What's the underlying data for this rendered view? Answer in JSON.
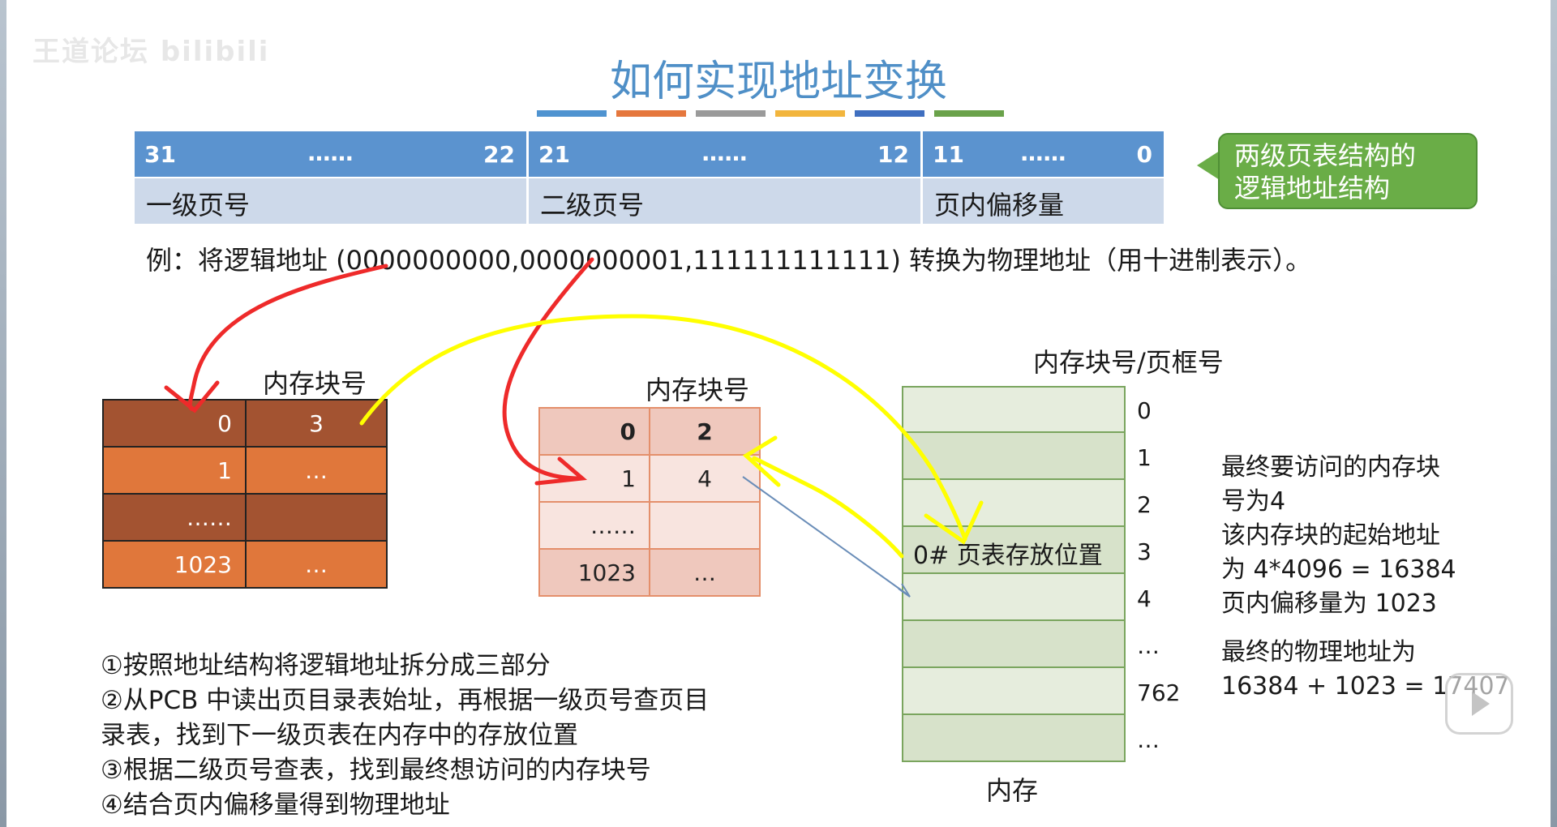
{
  "watermark": "王道论坛 bilibili",
  "title": "如何实现地址变换",
  "accent_colors": [
    "#4f93d0",
    "#e5773d",
    "#9a9a9a",
    "#f2b53d",
    "#3f6fc0",
    "#6aa24a"
  ],
  "address_structure": {
    "fields": [
      {
        "high_bit": "31",
        "dots": "……",
        "low_bit": "22",
        "label": "一级页号"
      },
      {
        "high_bit": "21",
        "dots": "……",
        "low_bit": "12",
        "label": "二级页号"
      },
      {
        "high_bit": "11",
        "dots": "……",
        "low_bit": "0",
        "label": "页内偏移量"
      }
    ],
    "callout_line1": "两级页表结构的",
    "callout_line2": "逻辑地址结构"
  },
  "example_text": "例：将逻辑地址 (0000000000,0000000001,111111111111) 转换为物理地址（用十进制表示）。",
  "page_directory": {
    "header": "内存块号",
    "rows": [
      {
        "index": "0",
        "value": "3"
      },
      {
        "index": "1",
        "value": "…"
      },
      {
        "index": "……",
        "value": ""
      },
      {
        "index": "1023",
        "value": "…"
      }
    ]
  },
  "second_level_table": {
    "header": "内存块号",
    "rows": [
      {
        "index": "0",
        "value": "2"
      },
      {
        "index": "1",
        "value": "4"
      },
      {
        "index": "……",
        "value": ""
      },
      {
        "index": "1023",
        "value": "…"
      }
    ]
  },
  "memory": {
    "header": "内存块号/页框号",
    "block_numbers": [
      "0",
      "1",
      "2",
      "3",
      "4",
      "…",
      "762",
      "…"
    ],
    "block3_text": "0# 页表存放位置",
    "label": "内存"
  },
  "notes": {
    "line1": "最终要访问的内存块",
    "line2": "号为4",
    "line3": "该内存块的起始地址",
    "line4": "为 4*4096 = 16384",
    "line5": "页内偏移量为 1023",
    "line6": "最终的物理地址为",
    "line7": "16384 + 1023 = 17407"
  },
  "steps": {
    "s1": "①按照地址结构将逻辑地址拆分成三部分",
    "s2a": "②从PCB 中读出页目录表始址，再根据一级页号查页目",
    "s2b": "录表，找到下一级页表在内存中的存放位置",
    "s3": "③根据二级页号查表，找到最终想访问的内存块号",
    "s4": "④结合页内偏移量得到物理地址"
  }
}
